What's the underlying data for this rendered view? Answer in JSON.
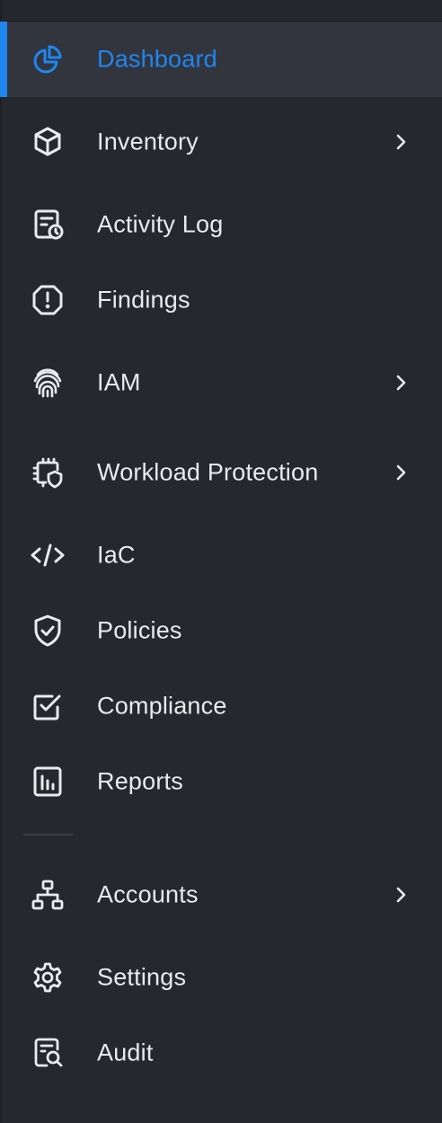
{
  "nav": {
    "items": [
      {
        "label": "Dashboard",
        "icon": "pie-chart-icon",
        "active": true,
        "has_submenu": false
      },
      {
        "label": "Inventory",
        "icon": "cube-icon",
        "active": false,
        "has_submenu": true
      },
      {
        "label": "Activity Log",
        "icon": "activity-log-icon",
        "active": false,
        "has_submenu": false
      },
      {
        "label": "Findings",
        "icon": "alert-octagon-icon",
        "active": false,
        "has_submenu": false
      },
      {
        "label": "IAM",
        "icon": "fingerprint-icon",
        "active": false,
        "has_submenu": true
      },
      {
        "label": "Workload Protection",
        "icon": "chip-shield-icon",
        "active": false,
        "has_submenu": true
      },
      {
        "label": "IaC",
        "icon": "code-icon",
        "active": false,
        "has_submenu": false
      },
      {
        "label": "Policies",
        "icon": "shield-check-icon",
        "active": false,
        "has_submenu": false
      },
      {
        "label": "Compliance",
        "icon": "checkbox-icon",
        "active": false,
        "has_submenu": false
      },
      {
        "label": "Reports",
        "icon": "bar-report-icon",
        "active": false,
        "has_submenu": false
      }
    ],
    "secondary_items": [
      {
        "label": "Accounts",
        "icon": "hierarchy-icon",
        "active": false,
        "has_submenu": true
      },
      {
        "label": "Settings",
        "icon": "gear-icon",
        "active": false,
        "has_submenu": false
      },
      {
        "label": "Audit",
        "icon": "audit-search-icon",
        "active": false,
        "has_submenu": false
      }
    ]
  },
  "colors": {
    "background": "#25282d",
    "active_background": "#32353d",
    "accent": "#1f86f0",
    "text": "#e9eaed"
  }
}
